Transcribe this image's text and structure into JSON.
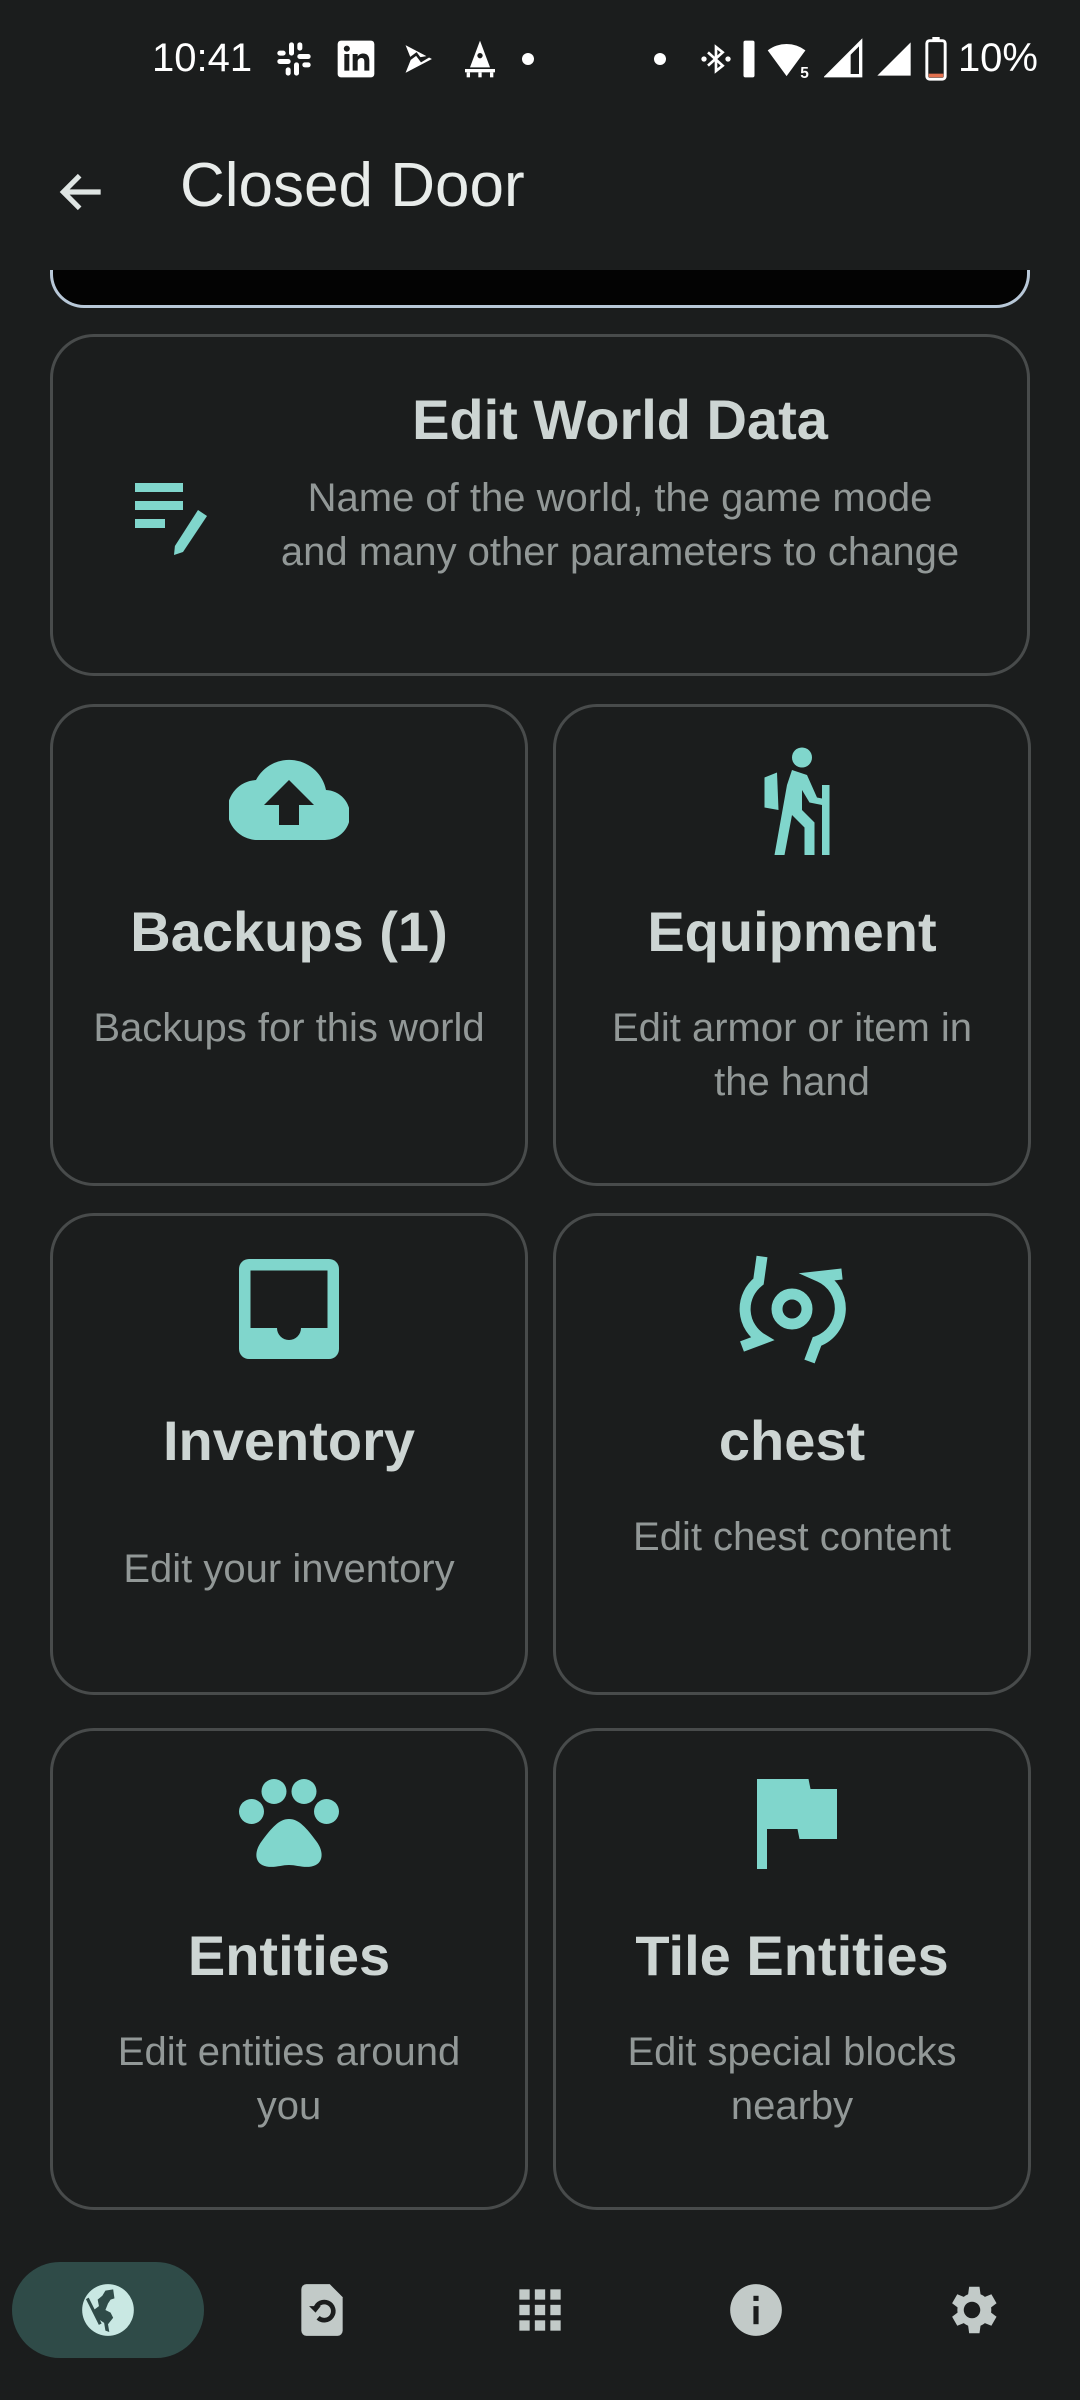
{
  "status_bar": {
    "time": "10:41",
    "notification_icons": [
      "slack-icon",
      "linkedin-icon",
      "app-icon",
      "rocket-icon"
    ],
    "system_icons": [
      "bluetooth-icon",
      "vibrate-icon",
      "wifi-icon",
      "signal-icon",
      "signal-icon",
      "battery-icon"
    ],
    "wifi_badge": "5",
    "battery_percent": "10%",
    "battery_level": 0.1,
    "battery_low_color": "#e2714f"
  },
  "app_bar": {
    "back_icon": "arrow-back-icon",
    "title": "Closed Door"
  },
  "theme": {
    "accent": "#80d6cc",
    "background": "#1b1d1d",
    "card_border": "#484b4b",
    "title_text": "#cdd5d3",
    "desc_text": "#929897",
    "nav_active_bg": "#2f4b48"
  },
  "wide_card": {
    "icon": "edit-note-icon",
    "title": "Edit World Data",
    "description": "Name of the world, the game mode and many other parameters to change"
  },
  "cards": [
    {
      "icon": "cloud-upload-icon",
      "title": "Backups (1)",
      "description": "Backups for this world"
    },
    {
      "icon": "hiker-icon",
      "title": "Equipment",
      "description": "Edit armor or item in the hand"
    },
    {
      "icon": "inbox-icon",
      "title": "Inventory",
      "description": "Edit your inventory"
    },
    {
      "icon": "cyclone-icon",
      "title": "chest",
      "description": "Edit chest content"
    },
    {
      "icon": "paw-icon",
      "title": "Entities",
      "description": "Edit entities around you"
    },
    {
      "icon": "flag-icon",
      "title": "Tile Entities",
      "description": "Edit special blocks nearby"
    }
  ],
  "bottom_nav": {
    "items": [
      {
        "icon": "globe-icon",
        "label": "World",
        "active": true
      },
      {
        "icon": "restore-file-icon",
        "label": "Restore",
        "active": false
      },
      {
        "icon": "apps-grid-icon",
        "label": "Apps",
        "active": false
      },
      {
        "icon": "info-icon",
        "label": "Info",
        "active": false
      },
      {
        "icon": "settings-gear-icon",
        "label": "Settings",
        "active": false
      }
    ]
  }
}
